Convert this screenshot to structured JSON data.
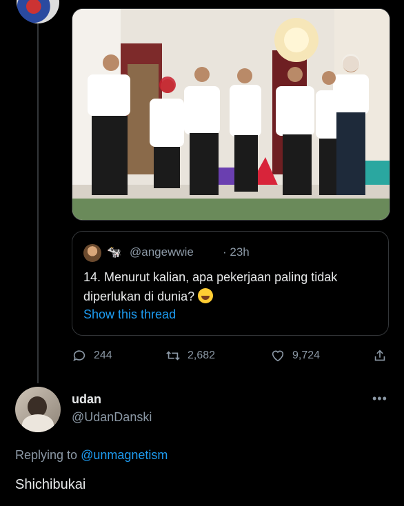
{
  "quoted": {
    "handle": "@angewwie",
    "time": "· 23h",
    "cow_emoji": "🐄",
    "text": "14. Menurut kalian, apa pekerjaan paling tidak diperlukan di dunia?",
    "show_thread": "Show this thread"
  },
  "actions": {
    "replies": "244",
    "retweets": "2,682",
    "likes": "9,724"
  },
  "reply": {
    "name": "udan",
    "handle": "@UdanDanski",
    "more": "•••",
    "replying_prefix": "Replying to",
    "replying_to": "@unmagnetism",
    "text": "Shichibukai"
  },
  "colors": {
    "background": "#000000",
    "accent": "#1d9bf0",
    "muted": "#8b98a5",
    "border": "#333639"
  }
}
